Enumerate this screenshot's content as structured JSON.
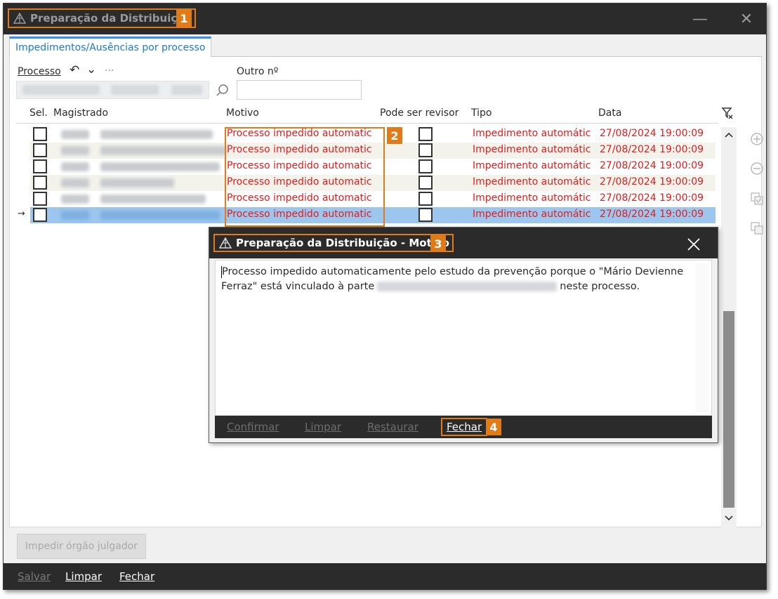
{
  "window": {
    "title": "Preparação da Distribuição",
    "title_badge": "1",
    "minimize_glyph": "—",
    "close_glyph": "✕"
  },
  "tabs": [
    "Impedimentos/Ausências por processo"
  ],
  "filters": {
    "processo_label": "Processo",
    "outro_label": "Outro nº",
    "outro_value": "",
    "more_glyph": "···",
    "undo_glyph": "↶",
    "chevron_glyph": "⌄"
  },
  "table": {
    "headers": [
      "Sel.",
      "Magistrado",
      "Motivo",
      "Pode ser revisor",
      "Tipo",
      "Data"
    ],
    "motivo_badge": "2",
    "rows": [
      {
        "motivo": "Processo impedido automatic",
        "tipo": "Impedimento automátic",
        "data": "27/08/2024 19:00:09",
        "selected": false
      },
      {
        "motivo": "Processo impedido automatic",
        "tipo": "Impedimento automátic",
        "data": "27/08/2024 19:00:09",
        "selected": false
      },
      {
        "motivo": "Processo impedido automatic",
        "tipo": "Impedimento automátic",
        "data": "27/08/2024 19:00:09",
        "selected": false
      },
      {
        "motivo": "Processo impedido automatic",
        "tipo": "Impedimento automátic",
        "data": "27/08/2024 19:00:09",
        "selected": false
      },
      {
        "motivo": "Processo impedido automatic",
        "tipo": "Impedimento automátic",
        "data": "27/08/2024 19:00:09",
        "selected": false
      },
      {
        "motivo": "Processo impedido automatic",
        "tipo": "Impedimento automátic",
        "data": "27/08/2024 19:00:09",
        "selected": true
      }
    ],
    "current_row_marker": "→"
  },
  "side_buttons": [
    "add-icon",
    "remove-icon",
    "check-copy-icon",
    "copy-icon"
  ],
  "impedir_button": "Impedir órgão julgador",
  "bottom_buttons": {
    "salvar": "Salvar",
    "limpar": "Limpar",
    "fechar": "Fechar"
  },
  "dialog": {
    "title": "Preparação da Distribuição - Motivo",
    "title_badge": "3",
    "text_part1": "Processo impedido automaticamente pelo estudo da prevenção porque o \"Mário Devienne Ferraz\" está vinculado à parte",
    "text_part2": "neste processo.",
    "buttons": {
      "confirmar": "Confirmar",
      "limpar": "Limpar",
      "restaurar": "Restaurar",
      "fechar": "Fechar"
    },
    "fechar_badge": "4"
  },
  "colors": {
    "accent_orange": "#e07b1a",
    "error_red": "#e31b1b",
    "selection_blue": "#9dc6ee",
    "tab_blue": "#1a7ad6",
    "dark_bar": "#2b2b2b"
  }
}
